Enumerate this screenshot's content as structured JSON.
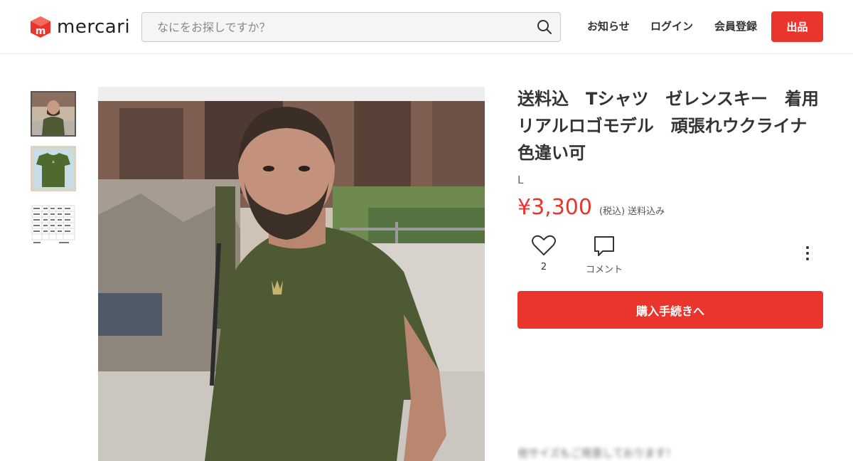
{
  "header": {
    "logo_text": "mercari",
    "search_placeholder": "なにをお探しですか？",
    "nav": {
      "news": "お知らせ",
      "login": "ログイン",
      "signup": "会員登録"
    },
    "sell_label": "出品"
  },
  "item": {
    "title": "送料込　Tシャツ　ゼレンスキー　着用リアルロゴモデル　頑張れウクライナ　色違い可",
    "size": "L",
    "price": "¥3,300",
    "tax_note": "(税込)",
    "shipping_note": "送料込み",
    "likes": "2",
    "comment_label": "コメント",
    "buy_label": "購入手続きへ",
    "description_visible_line": "他サイズもご用意しております！"
  },
  "colors": {
    "brand_red": "#ea352d",
    "border": "#e6e6e6",
    "shirt_olive": "#4e5a33"
  },
  "icons": {
    "logo": "mercari-logo-icon",
    "search": "search-icon",
    "next": "chevron-right-icon",
    "like": "heart-icon",
    "comment": "comment-icon",
    "more": "more-vertical-icon"
  }
}
